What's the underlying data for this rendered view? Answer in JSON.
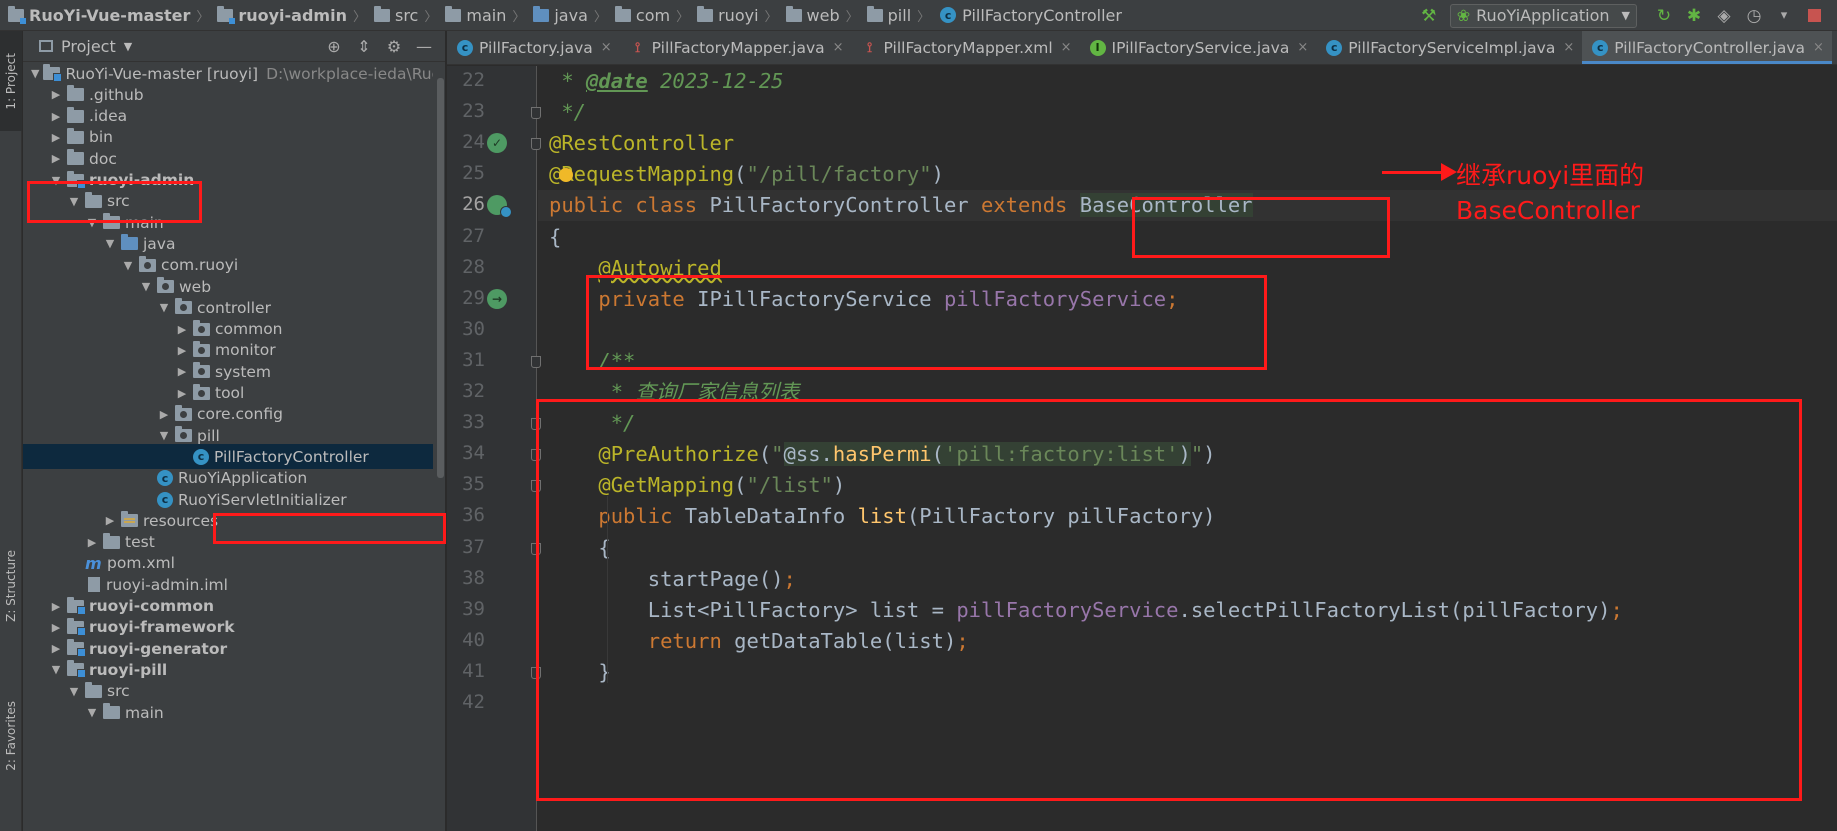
{
  "breadcrumbs": [
    {
      "label": "RuoYi-Vue-master",
      "bold": true,
      "icon": "module-folder"
    },
    {
      "label": "ruoyi-admin",
      "bold": true,
      "icon": "module-folder"
    },
    {
      "label": "src",
      "icon": "folder"
    },
    {
      "label": "main",
      "icon": "folder"
    },
    {
      "label": "java",
      "icon": "source-folder"
    },
    {
      "label": "com",
      "icon": "package"
    },
    {
      "label": "ruoyi",
      "icon": "package"
    },
    {
      "label": "web",
      "icon": "package"
    },
    {
      "label": "pill",
      "icon": "package"
    },
    {
      "label": "PillFactoryController",
      "icon": "class"
    }
  ],
  "run_config": {
    "label": "RuoYiApplication"
  },
  "tool_strip": {
    "project": "1: Project",
    "structure": "Z: Structure",
    "favorites": "2: Favorites"
  },
  "project_panel": {
    "title": "Project"
  },
  "tree": [
    {
      "label": "RuoYi-Vue-master [ruoyi]",
      "path": "D:\\workplace-ieda\\RuoY",
      "depth": 0,
      "arrow": "open",
      "icon": "module",
      "bold": false
    },
    {
      "label": ".github",
      "depth": 1,
      "arrow": "closed",
      "icon": "folder"
    },
    {
      "label": ".idea",
      "depth": 1,
      "arrow": "closed",
      "icon": "folder"
    },
    {
      "label": "bin",
      "depth": 1,
      "arrow": "closed",
      "icon": "folder"
    },
    {
      "label": "doc",
      "depth": 1,
      "arrow": "closed",
      "icon": "folder"
    },
    {
      "label": "ruoyi-admin",
      "depth": 1,
      "arrow": "open",
      "icon": "module",
      "bold": true
    },
    {
      "label": "src",
      "depth": 2,
      "arrow": "open",
      "icon": "folder"
    },
    {
      "label": "main",
      "depth": 3,
      "arrow": "open",
      "icon": "folder"
    },
    {
      "label": "java",
      "depth": 4,
      "arrow": "open",
      "icon": "source"
    },
    {
      "label": "com.ruoyi",
      "depth": 5,
      "arrow": "open",
      "icon": "package"
    },
    {
      "label": "web",
      "depth": 6,
      "arrow": "open",
      "icon": "package"
    },
    {
      "label": "controller",
      "depth": 7,
      "arrow": "open",
      "icon": "package"
    },
    {
      "label": "common",
      "depth": 8,
      "arrow": "closed",
      "icon": "package"
    },
    {
      "label": "monitor",
      "depth": 8,
      "arrow": "closed",
      "icon": "package"
    },
    {
      "label": "system",
      "depth": 8,
      "arrow": "closed",
      "icon": "package"
    },
    {
      "label": "tool",
      "depth": 8,
      "arrow": "closed",
      "icon": "package"
    },
    {
      "label": "core.config",
      "depth": 7,
      "arrow": "closed",
      "icon": "package"
    },
    {
      "label": "pill",
      "depth": 7,
      "arrow": "open",
      "icon": "package"
    },
    {
      "label": "PillFactoryController",
      "depth": 8,
      "arrow": "none",
      "icon": "class",
      "selected": true
    },
    {
      "label": "RuoYiApplication",
      "depth": 6,
      "arrow": "none",
      "icon": "class"
    },
    {
      "label": "RuoYiServletInitializer",
      "depth": 6,
      "arrow": "none",
      "icon": "class"
    },
    {
      "label": "resources",
      "depth": 4,
      "arrow": "closed",
      "icon": "resources"
    },
    {
      "label": "test",
      "depth": 3,
      "arrow": "closed",
      "icon": "folder"
    },
    {
      "label": "pom.xml",
      "depth": 2,
      "arrow": "none",
      "icon": "maven"
    },
    {
      "label": "ruoyi-admin.iml",
      "depth": 2,
      "arrow": "none",
      "icon": "iml"
    },
    {
      "label": "ruoyi-common",
      "depth": 1,
      "arrow": "closed",
      "icon": "module",
      "bold": true
    },
    {
      "label": "ruoyi-framework",
      "depth": 1,
      "arrow": "closed",
      "icon": "module",
      "bold": true
    },
    {
      "label": "ruoyi-generator",
      "depth": 1,
      "arrow": "closed",
      "icon": "module",
      "bold": true
    },
    {
      "label": "ruoyi-pill",
      "depth": 1,
      "arrow": "open",
      "icon": "module",
      "bold": true
    },
    {
      "label": "src",
      "depth": 2,
      "arrow": "open",
      "icon": "folder"
    },
    {
      "label": "main",
      "depth": 3,
      "arrow": "open",
      "icon": "folder"
    }
  ],
  "tabs": [
    {
      "label": "PillFactory.java",
      "icon": "class",
      "active": false
    },
    {
      "label": "PillFactoryMapper.java",
      "icon": "mapper",
      "active": false
    },
    {
      "label": "PillFactoryMapper.xml",
      "icon": "mapper",
      "active": false
    },
    {
      "label": "IPillFactoryService.java",
      "icon": "interface",
      "active": false
    },
    {
      "label": "PillFactoryServiceImpl.java",
      "icon": "class",
      "active": false
    },
    {
      "label": "PillFactoryController.java",
      "icon": "class",
      "active": true
    }
  ],
  "editor": {
    "current_line": 26,
    "lines": [
      {
        "n": 22,
        "tokens": [
          [
            " * ",
            "cmt"
          ],
          [
            "@date",
            "doctag"
          ],
          [
            " 2023-12-25",
            "cmt"
          ]
        ]
      },
      {
        "n": 23,
        "tokens": [
          [
            " */",
            "cmt"
          ]
        ]
      },
      {
        "n": 24,
        "tokens": [
          [
            "@RestController",
            "ann"
          ]
        ]
      },
      {
        "n": 25,
        "tokens": [
          [
            "@RequestMapping",
            "ann"
          ],
          [
            "(",
            "plain"
          ],
          [
            "\"/pill/factory\"",
            "str"
          ],
          [
            ")",
            "plain"
          ]
        ]
      },
      {
        "n": 26,
        "tokens": [
          [
            "public class ",
            "kw"
          ],
          [
            "PillFactoryController ",
            "plain"
          ],
          [
            "extends ",
            "kw"
          ],
          [
            "BaseController",
            "plain hl"
          ]
        ]
      },
      {
        "n": 27,
        "tokens": [
          [
            "{",
            "plain"
          ]
        ]
      },
      {
        "n": 28,
        "tokens": [
          [
            "    ",
            "plain"
          ],
          [
            "@Autowired",
            "ann warn-u"
          ]
        ]
      },
      {
        "n": 29,
        "tokens": [
          [
            "    ",
            "plain"
          ],
          [
            "private ",
            "kw"
          ],
          [
            "IPillFactoryService ",
            "plain"
          ],
          [
            "pillFactoryService",
            "field"
          ],
          [
            ";",
            "kw"
          ]
        ]
      },
      {
        "n": 30,
        "tokens": []
      },
      {
        "n": 31,
        "tokens": [
          [
            "    ",
            "plain"
          ],
          [
            "/**",
            "cmt"
          ]
        ]
      },
      {
        "n": 32,
        "tokens": [
          [
            "    ",
            "plain"
          ],
          [
            " * 查询厂家信息列表",
            "cmt"
          ]
        ]
      },
      {
        "n": 33,
        "tokens": [
          [
            "    ",
            "plain"
          ],
          [
            " */",
            "cmt"
          ]
        ]
      },
      {
        "n": 34,
        "tokens": [
          [
            "    ",
            "plain"
          ],
          [
            "@PreAuthorize",
            "ann"
          ],
          [
            "(",
            "plain"
          ],
          [
            "\"",
            "str"
          ],
          [
            "@ss.",
            "plain hl"
          ],
          [
            "hasPermi",
            "meth hl"
          ],
          [
            "(",
            "plain hl"
          ],
          [
            "'pill:factory:list'",
            "str hl"
          ],
          [
            ")",
            "plain hl"
          ],
          [
            "\"",
            "str"
          ],
          [
            ")",
            "plain"
          ]
        ]
      },
      {
        "n": 35,
        "tokens": [
          [
            "    ",
            "plain"
          ],
          [
            "@GetMapping",
            "ann"
          ],
          [
            "(",
            "plain"
          ],
          [
            "\"/list\"",
            "str"
          ],
          [
            ")",
            "plain"
          ]
        ]
      },
      {
        "n": 36,
        "tokens": [
          [
            "    ",
            "plain"
          ],
          [
            "public ",
            "kw"
          ],
          [
            "TableDataInfo ",
            "plain"
          ],
          [
            "list",
            "meth"
          ],
          [
            "(PillFactory pillFactory)",
            "plain"
          ]
        ]
      },
      {
        "n": 37,
        "tokens": [
          [
            "    ",
            "plain"
          ],
          [
            "{",
            "plain"
          ]
        ]
      },
      {
        "n": 38,
        "tokens": [
          [
            "        ",
            "plain"
          ],
          [
            "startPage",
            "plain"
          ],
          [
            "()",
            "plain"
          ],
          [
            ";",
            "kw"
          ]
        ]
      },
      {
        "n": 39,
        "tokens": [
          [
            "        ",
            "plain"
          ],
          [
            "List<PillFactory> list = ",
            "plain"
          ],
          [
            "pillFactoryService",
            "field"
          ],
          [
            ".selectPillFactoryList(pillFactory)",
            "plain"
          ],
          [
            ";",
            "kw"
          ]
        ]
      },
      {
        "n": 40,
        "tokens": [
          [
            "        ",
            "plain"
          ],
          [
            "return ",
            "kw"
          ],
          [
            "getDataTable(list)",
            "plain"
          ],
          [
            ";",
            "kw"
          ]
        ]
      },
      {
        "n": 41,
        "tokens": [
          [
            "    ",
            "plain"
          ],
          [
            "}",
            "plain"
          ]
        ]
      },
      {
        "n": 42,
        "tokens": []
      }
    ]
  },
  "annotation": {
    "note": "继承ruoyi里面的BaseController",
    "color": "#ff1a1a"
  },
  "colors": {
    "keyword": "#cc7832",
    "annotation": "#bbb529",
    "string": "#6a8759",
    "comment": "#629755",
    "field": "#9876aa",
    "method": "#ffc66d",
    "text": "#a9b7c6",
    "background": "#2b2b2b"
  }
}
